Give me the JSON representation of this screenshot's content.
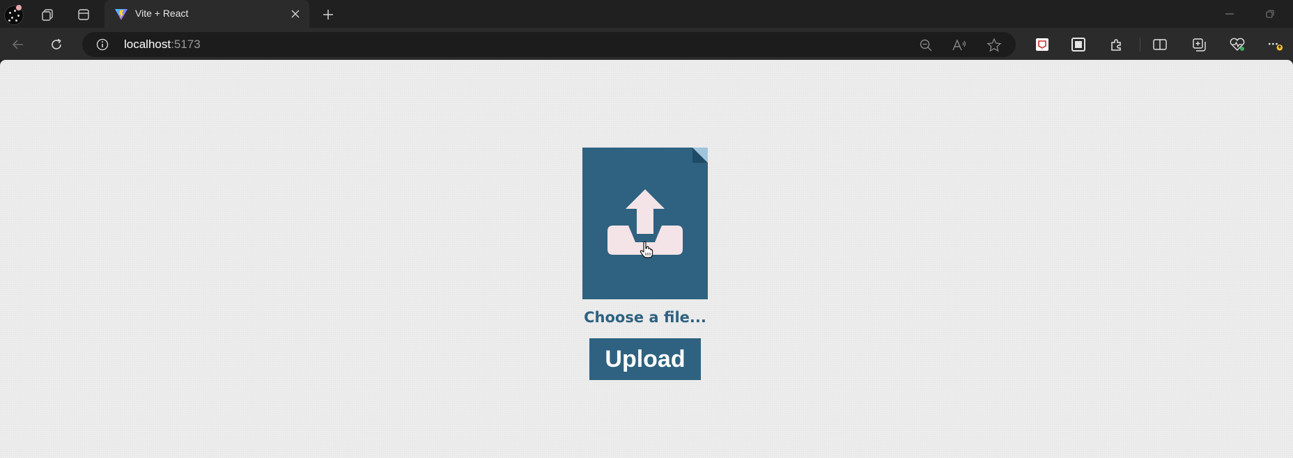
{
  "browser": {
    "tab": {
      "title": "Vite + React"
    },
    "address": {
      "host": "localhost",
      "port": ":5173"
    },
    "colors": {
      "chrome": "#202020",
      "toolbar": "#2b2b2b",
      "omnibox": "#1c1c1c"
    }
  },
  "page": {
    "file_input": {
      "label": "Choose a file...",
      "icon": "upload-tray-icon"
    },
    "upload_button": {
      "label": "Upload"
    },
    "colors": {
      "accent": "#2e6280",
      "background": "#ececec",
      "icon_fill": "#f4e4e8"
    }
  }
}
